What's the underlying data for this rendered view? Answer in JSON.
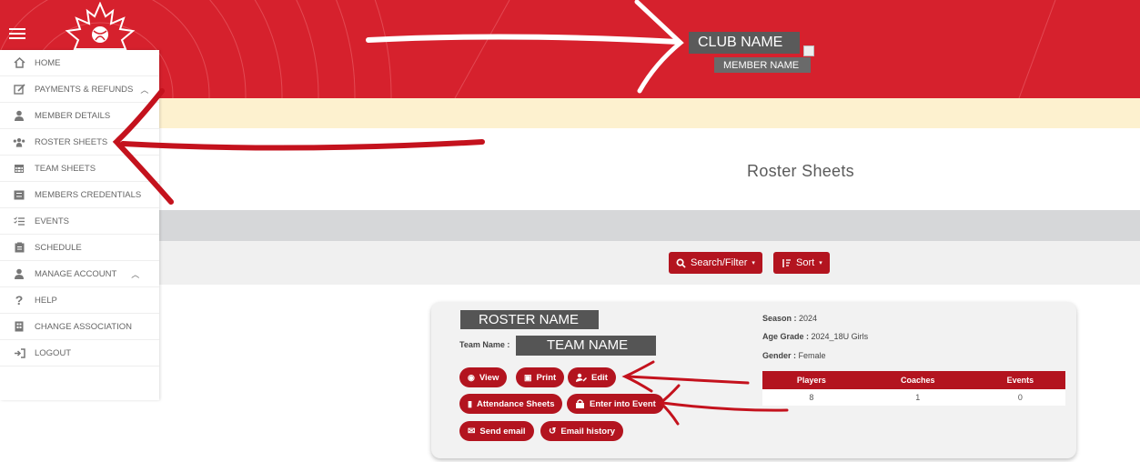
{
  "header": {
    "club_name": "CLUB NAME",
    "member_name": "MEMBER NAME",
    "brand_color": "#d6212d"
  },
  "sidebar": {
    "items": [
      {
        "label": "HOME",
        "icon": "home-icon"
      },
      {
        "label": "PAYMENTS & REFUNDS",
        "icon": "edit-icon",
        "chevron": "^"
      },
      {
        "label": "MEMBER DETAILS",
        "icon": "user-icon"
      },
      {
        "label": "ROSTER SHEETS",
        "icon": "users-icon"
      },
      {
        "label": "TEAM SHEETS",
        "icon": "calendar-icon"
      },
      {
        "label": "MEMBERS CREDENTIALS",
        "icon": "list-icon"
      },
      {
        "label": "EVENTS",
        "icon": "checklist-icon"
      },
      {
        "label": "SCHEDULE",
        "icon": "clipboard-icon"
      },
      {
        "label": "MANAGE ACCOUNT",
        "icon": "user-icon",
        "chevron": "^"
      },
      {
        "label": "HELP",
        "icon": "question-icon"
      },
      {
        "label": "CHANGE ASSOCIATION",
        "icon": "building-icon"
      },
      {
        "label": "LOGOUT",
        "icon": "logout-icon"
      }
    ]
  },
  "main": {
    "title": "Roster Sheets",
    "search_label": "Search/Filter",
    "sort_label": "Sort"
  },
  "card": {
    "roster_name": "ROSTER NAME",
    "team_label": "Team Name :",
    "team_name": "TEAM NAME",
    "season_label": "Season :",
    "season_value": "2024",
    "age_label": "Age Grade :",
    "age_value": "2024_18U Girls",
    "gender_label": "Gender :",
    "gender_value": "Female",
    "buttons": {
      "view": "View",
      "print": "Print",
      "edit": "Edit",
      "attendance": "Attendance Sheets",
      "enter_event": "Enter into Event",
      "send_email": "Send email",
      "email_history": "Email history"
    },
    "stats": {
      "headers": [
        "Players",
        "Coaches",
        "Events"
      ],
      "values": [
        "8",
        "1",
        "0"
      ]
    }
  }
}
